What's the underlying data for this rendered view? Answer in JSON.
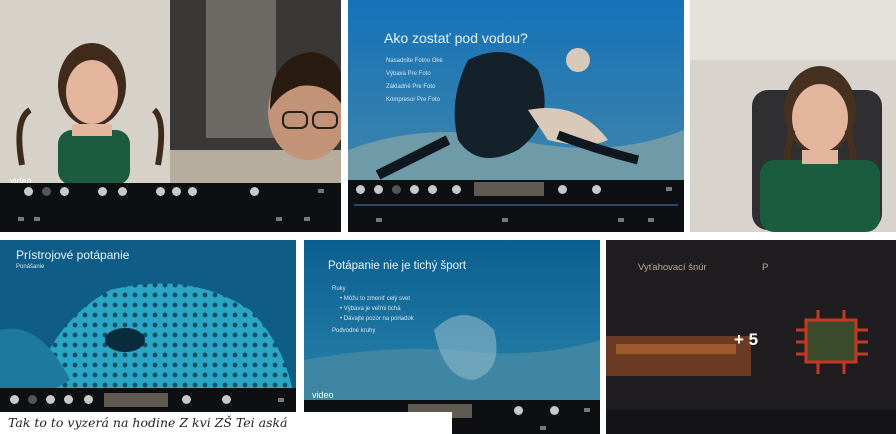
{
  "tiles": {
    "t1": {
      "label": "video"
    },
    "t2": {
      "title": "Ako zostať pod vodou?",
      "bullets": [
        "Nasadnite Fotno Oké",
        "Výbava Pre Foto",
        "Základné Pre Foto",
        "Kompresor Pre Foto"
      ]
    },
    "t4": {
      "title": "Prístrojové potápanie",
      "subtitle": "Ponášanie"
    },
    "t5": {
      "title": "Potápanie nie je tichý šport",
      "bullets": [
        "Ruky",
        "• Môžu to zmeniť celý svet",
        "• Výbava je veľmi tichá",
        "• Dávajte pozor na poriadok",
        "Podvodné kruhy"
      ],
      "label": "video"
    },
    "t6": {
      "title": "Vyťahovací šnúr",
      "marker": "P",
      "plus": "+ 5"
    }
  },
  "caption": "Tak to to vyzerá na hodine Z kvi ZŠ Tei aská"
}
